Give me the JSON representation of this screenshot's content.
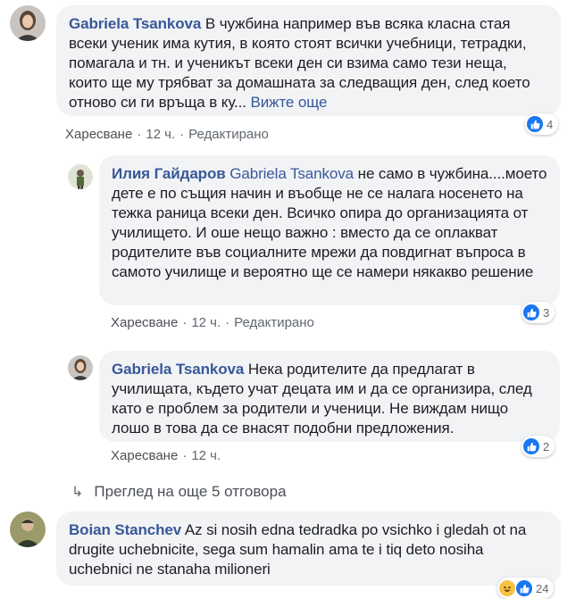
{
  "comments": [
    {
      "name": "Gabriela Tsankova",
      "text": "В чужбина например във всяка класна стая всеки ученик има кутия, в която стоят всички учебници, тетрадки, помагала и тн. и ученикът всеки ден си взима само тези неща, които ще му трябват за домашната за следващия ден, след което отново си ги връща в ку...",
      "see_more": "Вижте още",
      "like_label": "Харесване",
      "time": "12 ч.",
      "edited": "Редактирано",
      "reaction_count": "4"
    }
  ],
  "replies": [
    {
      "name": "Илия Гайдаров",
      "mention": "Gabriela Tsankova",
      "text": " не само в чужбина....моето дете е по същия начин и въобще не се налага носенето на тежка раница всеки ден. Всичко опира до организацията от училището. И оше нещо важно : вместо да се оплакват родителите във социалните мрежи да повдигнат въпроса в самото училище и вероятно ще се намери някакво решение",
      "like_label": "Харесване",
      "time": "12 ч.",
      "edited": "Редактирано",
      "reaction_count": "3"
    },
    {
      "name": "Gabriela Tsankova",
      "text": "Нека родителите да предлагат в училищата, където учат децата им и да се организира, след като е проблем за родители и ученици. Не виждам нищо лошо в това да се внасят подобни предложения.",
      "like_label": "Харесване",
      "time": "12 ч.",
      "reaction_count": "2"
    }
  ],
  "more_replies": {
    "arrow": "↳",
    "label": "Преглед на още 5 отговора"
  },
  "last_comment": {
    "name": "Boian Stanchev",
    "text": "Az si nosih edna tedradka po vsichko i gledah ot na drugite uchebnicite, sega sum hamalin ama te i tiq deto nosiha uchebnici ne stanaha milioneri",
    "reaction_count": "24"
  },
  "separator": "·",
  "colors": {
    "link_blue": "#385898",
    "bubble_bg": "#f2f3f5",
    "like_blue": "#1877f2",
    "haha_yellow": "#f7c244"
  },
  "icons": [
    "like-icon",
    "haha-icon",
    "reply-arrow-icon",
    "avatar"
  ]
}
